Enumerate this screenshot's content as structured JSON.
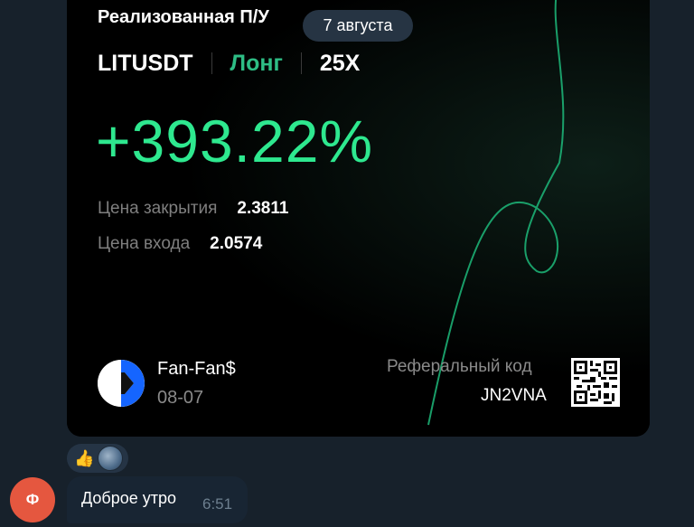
{
  "card": {
    "title": "Реализованная П/У",
    "pair": "LITUSDT",
    "side": "Лонг",
    "leverage": "25X",
    "pnl": "+393.22%",
    "close_price_label": "Цена закрытия",
    "close_price_value": "2.3811",
    "entry_price_label": "Цена входа",
    "entry_price_value": "2.0574",
    "user_name": "Fan-Fan$",
    "user_date": "08-07",
    "referral_label": "Реферальный код",
    "referral_code": "JN2VNA"
  },
  "date_pill": "7 августа",
  "reactions": {
    "emoji": "👍"
  },
  "message": {
    "sender_initial": "Ф",
    "text": "Доброе утро",
    "time": "6:51"
  },
  "colors": {
    "accent_green": "#2ee88f",
    "chat_bg": "#17212b",
    "avatar_bg": "#e5573f",
    "pill_bg": "#263443"
  },
  "icons": {
    "brand": "circle-logo-icon",
    "qr": "qr-code-icon",
    "reaction": "thumbs-up-icon"
  }
}
